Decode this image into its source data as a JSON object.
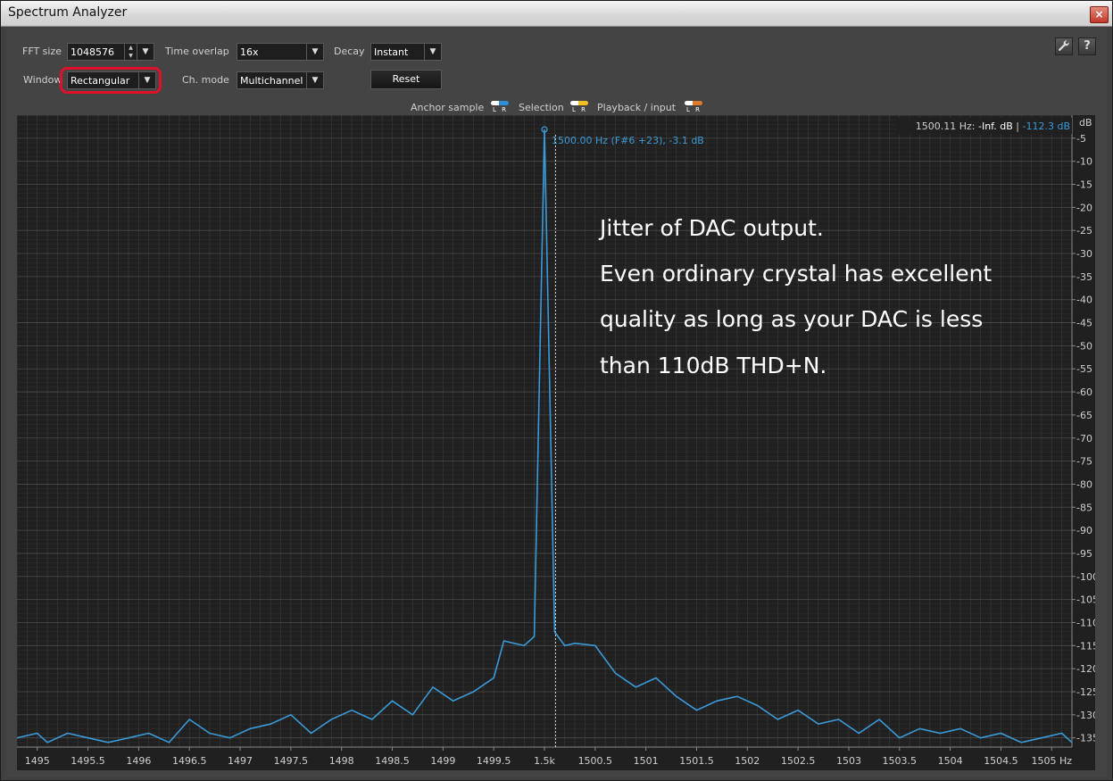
{
  "window": {
    "title": "Spectrum Analyzer",
    "close_glyph": "×"
  },
  "controls": {
    "fft_size": {
      "label": "FFT size",
      "value": "1048576"
    },
    "time_overlap": {
      "label": "Time overlap",
      "value": "16x"
    },
    "decay": {
      "label": "Decay",
      "value": "Instant"
    },
    "window": {
      "label": "Window",
      "value": "Rectangular"
    },
    "ch_mode": {
      "label": "Ch. mode",
      "value": "Multichannel"
    },
    "reset_label": "Reset",
    "settings_icon": "wrench-icon",
    "help_icon": "question-icon",
    "help_glyph": "?"
  },
  "legend": [
    {
      "label": "Anchor sample",
      "color": "#2f8fd8"
    },
    {
      "label": "Selection",
      "color": "#f0c020"
    },
    {
      "label": "Playback / input",
      "color": "#e07a2a"
    }
  ],
  "legend_lr": "L R",
  "readout": {
    "freq": "1500.11 Hz:",
    "value": "-Inf. dB",
    "sep": "|",
    "anchor": "-112.3 dB"
  },
  "peak_label": "1500.00 Hz (F#6 +23), -3.1 dB",
  "annotation": [
    "Jitter of DAC output.",
    "Even ordinary crystal has excellent",
    "quality as long as your DAC is less",
    "than 110dB THD+N."
  ],
  "colors": {
    "line": "#3a9ad8",
    "plot_bg": "#202020",
    "grid": "#3b3b3b"
  },
  "chart_data": {
    "type": "line",
    "xlabel": "Hz",
    "ylabel": "dB",
    "xlim": [
      1494.8,
      1505.2
    ],
    "ylim": [
      -137,
      0
    ],
    "x_ticks": [
      1495,
      1495.5,
      1496,
      1496.5,
      1497,
      1497.5,
      1498,
      1498.5,
      1499,
      1499.5,
      1500,
      1500.5,
      1501,
      1501.5,
      1502,
      1502.5,
      1503,
      1503.5,
      1504,
      1504.5,
      1505
    ],
    "x_tick_labels": [
      "1495",
      "1495.5",
      "1496",
      "1496.5",
      "1497",
      "1497.5",
      "1498",
      "1498.5",
      "1499",
      "1499.5",
      "1.5k",
      "1500.5",
      "1501",
      "1501.5",
      "1502",
      "1502.5",
      "1503",
      "1503.5",
      "1504",
      "1504.5",
      "1505 Hz"
    ],
    "y_ticks": [
      -5,
      -10,
      -15,
      -20,
      -25,
      -30,
      -35,
      -40,
      -45,
      -50,
      -55,
      -60,
      -65,
      -70,
      -75,
      -80,
      -85,
      -90,
      -95,
      -100,
      -105,
      -110,
      -115,
      -120,
      -125,
      -130,
      -135
    ],
    "y_tick_labels": [
      "-5",
      "-10",
      "-15",
      "-20",
      "-25",
      "-30",
      "-35",
      "-40",
      "-45",
      "-50",
      "-55",
      "-60",
      "-65",
      "-70",
      "-75",
      "-80",
      "-85",
      "-90",
      "-95",
      "-100",
      "-105",
      "-110",
      "-115",
      "-120",
      "-125",
      "-130",
      "-135"
    ],
    "y_unit_label": "dB",
    "grid": true,
    "cursor_x": 1500.11,
    "series": [
      {
        "color": "#3a9ad8",
        "x": [
          1494.8,
          1495.0,
          1495.1,
          1495.3,
          1495.5,
          1495.7,
          1495.9,
          1496.1,
          1496.3,
          1496.5,
          1496.7,
          1496.9,
          1497.1,
          1497.3,
          1497.5,
          1497.7,
          1497.9,
          1498.1,
          1498.3,
          1498.5,
          1498.7,
          1498.9,
          1499.1,
          1499.3,
          1499.5,
          1499.6,
          1499.8,
          1499.9,
          1500.0,
          1500.1,
          1500.2,
          1500.3,
          1500.5,
          1500.7,
          1500.9,
          1501.1,
          1501.3,
          1501.5,
          1501.7,
          1501.9,
          1502.1,
          1502.3,
          1502.5,
          1502.7,
          1502.9,
          1503.1,
          1503.3,
          1503.5,
          1503.7,
          1503.9,
          1504.1,
          1504.3,
          1504.5,
          1504.7,
          1504.9,
          1505.1,
          1505.2
        ],
        "y": [
          -135,
          -134,
          -136,
          -134,
          -135,
          -136,
          -135,
          -134,
          -136,
          -131,
          -134,
          -135,
          -133,
          -132,
          -130,
          -134,
          -131,
          -129,
          -131,
          -127,
          -130,
          -124,
          -127,
          -125,
          -122,
          -114,
          -115,
          -113,
          -3.1,
          -112,
          -115,
          -114.5,
          -115,
          -121,
          -124,
          -122,
          -126,
          -129,
          -127,
          -126,
          -128,
          -131,
          -129,
          -132,
          -131,
          -134,
          -131,
          -135,
          -133,
          -134,
          -133,
          -135,
          -134,
          -136,
          -135,
          -134,
          -136
        ]
      }
    ]
  }
}
